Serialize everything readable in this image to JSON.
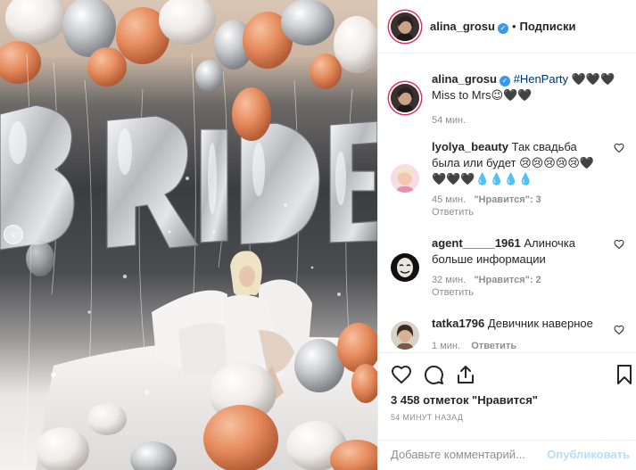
{
  "post": {
    "photo_letters": "BRIDE",
    "carousel_prev_icon": "chevron-left-icon"
  },
  "header": {
    "username": "alina_grosu",
    "dot": "•",
    "follow_label": "Подписки"
  },
  "caption": {
    "username": "alina_grosu",
    "hashtag": "#HenParty",
    "text_after_hashtag": " 🖤🖤🖤",
    "line2": "Miss to Mrs😉🖤🖤",
    "time": "54 мин."
  },
  "comments": [
    {
      "username": "lyolya_beauty",
      "text": "Так свадьба была или будет 😢😢😢😢😢🖤🖤🖤🖤💧💧💧💧",
      "time": "45 мин.",
      "likes": "\"Нравится\": 3",
      "reply": "Ответить"
    },
    {
      "username": "agent_____1961",
      "text": "Алиночка больше информации",
      "time": "32 мин.",
      "likes": "\"Нравится\": 2",
      "reply": "Ответить"
    },
    {
      "username": "tatka1796",
      "text": "Девичник наверное",
      "time": "1 мин.",
      "reply": "Ответить"
    }
  ],
  "actions": {
    "likes_text": "3 458 отметок \"Нравится\"",
    "timestamp": "54 МИНУТ НАЗАД"
  },
  "add_comment": {
    "placeholder": "Добавьте комментарий...",
    "publish_label": "Опубликовать"
  },
  "colors": {
    "verified": "#3897f0",
    "story_ring": "#e1306c",
    "hashtag": "#003569",
    "publish_disabled": "#b2dffc"
  }
}
